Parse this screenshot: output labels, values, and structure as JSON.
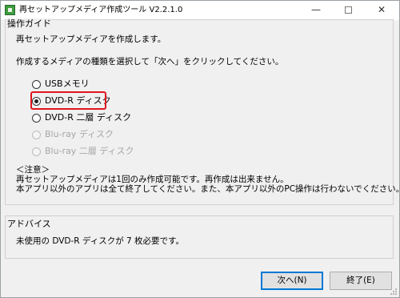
{
  "window": {
    "title": "再セットアップメディア作成ツール V2.2.1.0",
    "minimize": "—",
    "close": "✕"
  },
  "guide": {
    "label": "操作ガイド",
    "intro": "再セットアップメディアを作成します。",
    "instruction": "作成するメディアの種類を選択して「次へ」をクリックしてください。",
    "options": [
      {
        "label": "USBメモリ",
        "selected": false,
        "enabled": true
      },
      {
        "label": "DVD-R ディスク",
        "selected": true,
        "enabled": true
      },
      {
        "label": "DVD-R 二層 ディスク",
        "selected": false,
        "enabled": true
      },
      {
        "label": "Blu-ray ディスク",
        "selected": false,
        "enabled": false
      },
      {
        "label": "Blu-ray 二層 ディスク",
        "selected": false,
        "enabled": false
      }
    ],
    "note_title": "＜注意＞",
    "note_line1": "再セットアップメディアは1回のみ作成可能です。再作成は出来ません。",
    "note_line2": "本アプリ以外のアプリは全て終了してください。また、本アプリ以外のPC操作は行わないでください。"
  },
  "advice": {
    "label": "アドバイス",
    "text": "未使用の DVD-R ディスクが 7 枚必要です。"
  },
  "buttons": {
    "next": "次へ(N)",
    "exit": "終了(E)"
  },
  "colors": {
    "highlight": "#e0161b",
    "default_button_border": "#0078d7"
  }
}
